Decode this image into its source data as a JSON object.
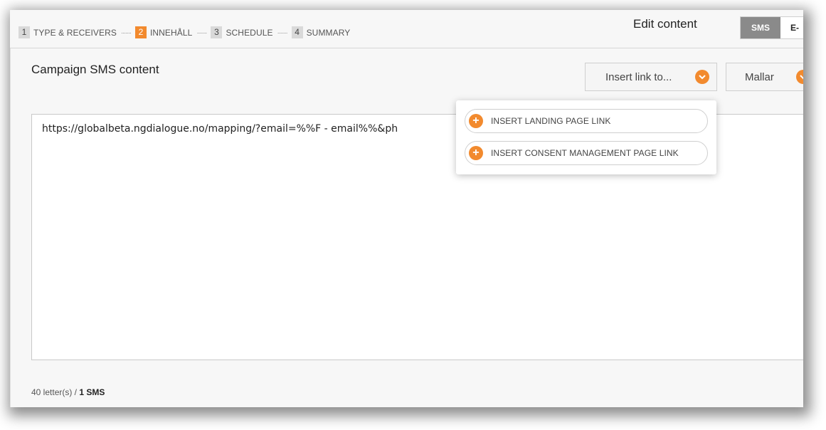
{
  "steps": [
    {
      "num": "1",
      "label": "TYPE & RECEIVERS",
      "active": false
    },
    {
      "num": "2",
      "label": "INNEHÅLL",
      "active": true
    },
    {
      "num": "3",
      "label": "SCHEDULE",
      "active": false
    },
    {
      "num": "4",
      "label": "SUMMARY",
      "active": false
    }
  ],
  "step_separator": "·······",
  "header": {
    "edit_title": "Edit content",
    "channel_sms": "SMS",
    "channel_email": "E-"
  },
  "content": {
    "title": "Campaign SMS content",
    "insert_link_label": "Insert link to...",
    "mallar_label": "Mallar",
    "message_text": "https://globalbeta.ngdialogue.no/mapping/?email=%%F - email%%&ph",
    "counter_prefix": "40 letter(s) / ",
    "counter_sms": "1 SMS"
  },
  "dropdown": {
    "items": [
      {
        "label": "INSERT LANDING PAGE LINK"
      },
      {
        "label": "INSERT CONSENT MANAGEMENT PAGE LINK"
      }
    ]
  },
  "icons": {
    "chevron": "chevron-down-icon",
    "plus": "plus-icon"
  },
  "colors": {
    "accent": "#f28a2e",
    "sms_tab": "#8a8a8a"
  }
}
